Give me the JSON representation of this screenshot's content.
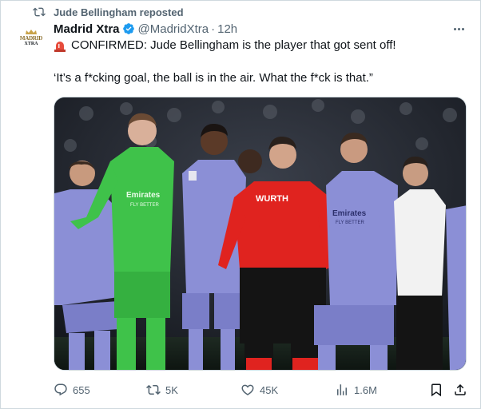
{
  "repost_banner": {
    "text": "Jude Bellingham reposted",
    "icon": "repost-icon"
  },
  "author": {
    "name": "Madrid Xtra",
    "handle": "@MadridXtra",
    "separator": "·",
    "time": "12h",
    "verified": true,
    "avatar": {
      "line1": "MADRID",
      "line2": "XTRA"
    }
  },
  "tweet": {
    "line1_emoji": "siren-icon",
    "line1": "CONFIRMED: Jude Bellingham is the player that got sent off!",
    "line2": "‘It’s a f*cking goal, the ball is in the air. What the f*ck is that.”"
  },
  "media": {
    "referee_shirt_text": "WURTH",
    "kit_sponsor_text": "Emirates",
    "kit_sponsor_sub": "FLY BETTER"
  },
  "actions": {
    "replies": "655",
    "reposts": "5K",
    "likes": "45K",
    "views": "1.6M"
  },
  "colors": {
    "text_primary": "#0f1419",
    "text_secondary": "#536471",
    "verified": "#1d9bf0",
    "border": "#cfd9de",
    "referee_red": "#e0231f",
    "keeper_green": "#3fc24a",
    "away_kit_lavender": "#8b8fd6"
  }
}
